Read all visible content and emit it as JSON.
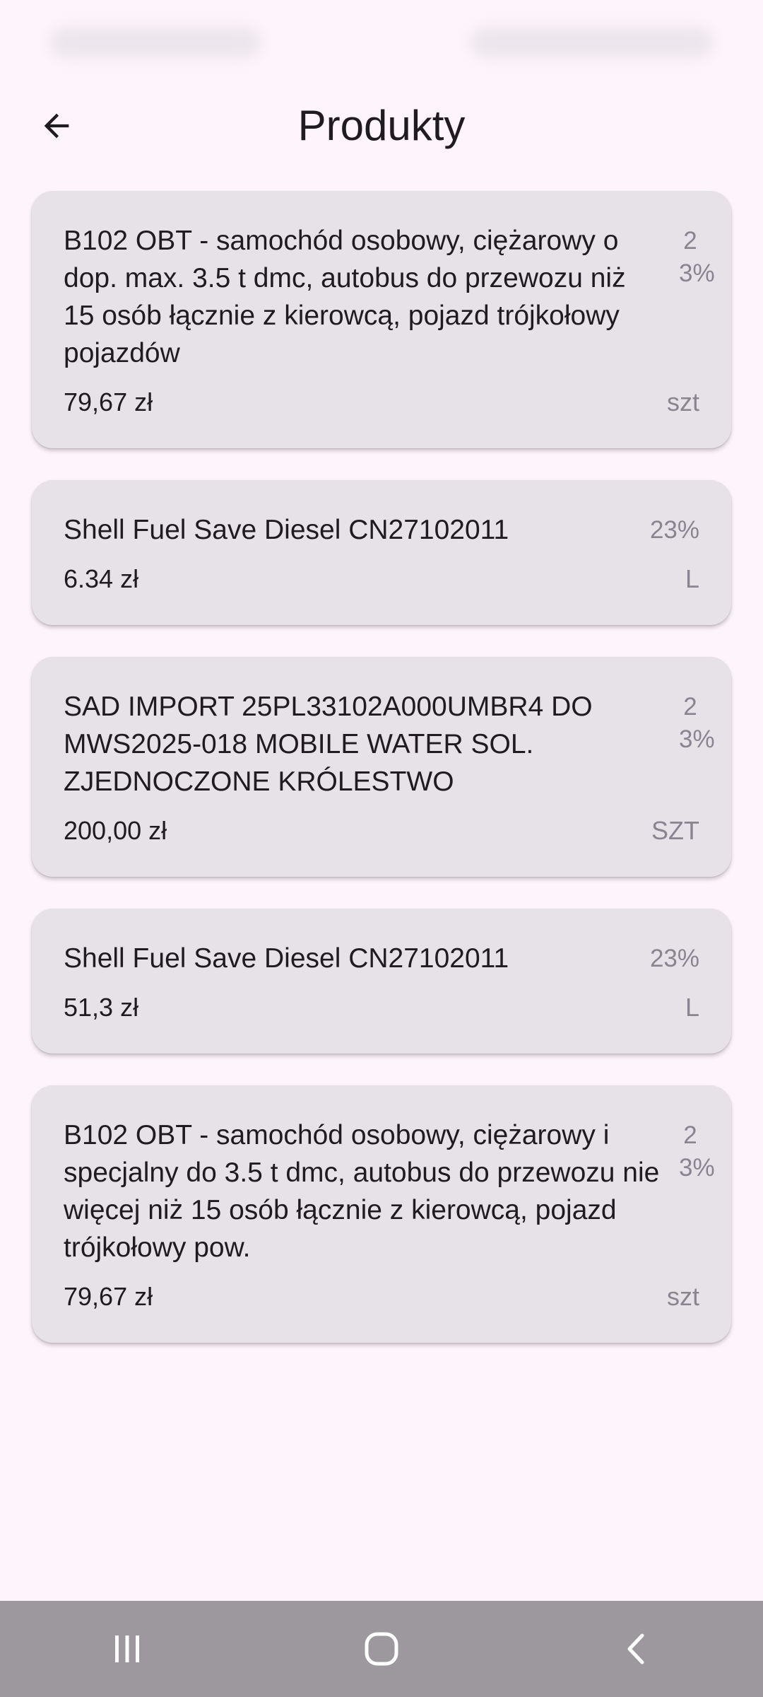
{
  "header": {
    "title": "Produkty",
    "back_icon": "arrow-left-icon"
  },
  "products": [
    {
      "name": "B102 OBT - samochód osobowy, ciężarowy o dop. max. 3.5 t dmc, autobus do przewozu niż 15 osób łącznie z kierowcą, pojazd trójkołowy pojazdów",
      "tax": "23%",
      "price": "79,67 zł",
      "unit": "szt"
    },
    {
      "name": "Shell Fuel Save Diesel CN27102011",
      "tax": "23%",
      "price": "6.34 zł",
      "unit": "L"
    },
    {
      "name": "SAD IMPORT 25PL33102A000UMBR4 DO MWS2025-018 MOBILE WATER SOL. ZJEDNOCZONE KRÓLESTWO",
      "tax": "23%",
      "price": "200,00 zł",
      "unit": "SZT"
    },
    {
      "name": "Shell Fuel Save Diesel CN27102011",
      "tax": "23%",
      "price": "51,3 zł",
      "unit": "L"
    },
    {
      "name": "B102 OBT - samochód osobowy, ciężarowy i specjalny do 3.5 t dmc, autobus do przewozu nie więcej niż 15 osób łącznie z kierowcą, pojazd trójkołowy pow.",
      "tax": "23%",
      "price": "79,67 zł",
      "unit": "szt"
    }
  ],
  "navigation": {
    "recents_icon": "recents-icon",
    "home_icon": "home-icon",
    "back_icon": "back-chevron-icon"
  },
  "colors": {
    "background": "#fdf5fb",
    "card": "#e7e1e8",
    "muted_text": "#8a8490",
    "nav_bar": "#9d979e"
  }
}
